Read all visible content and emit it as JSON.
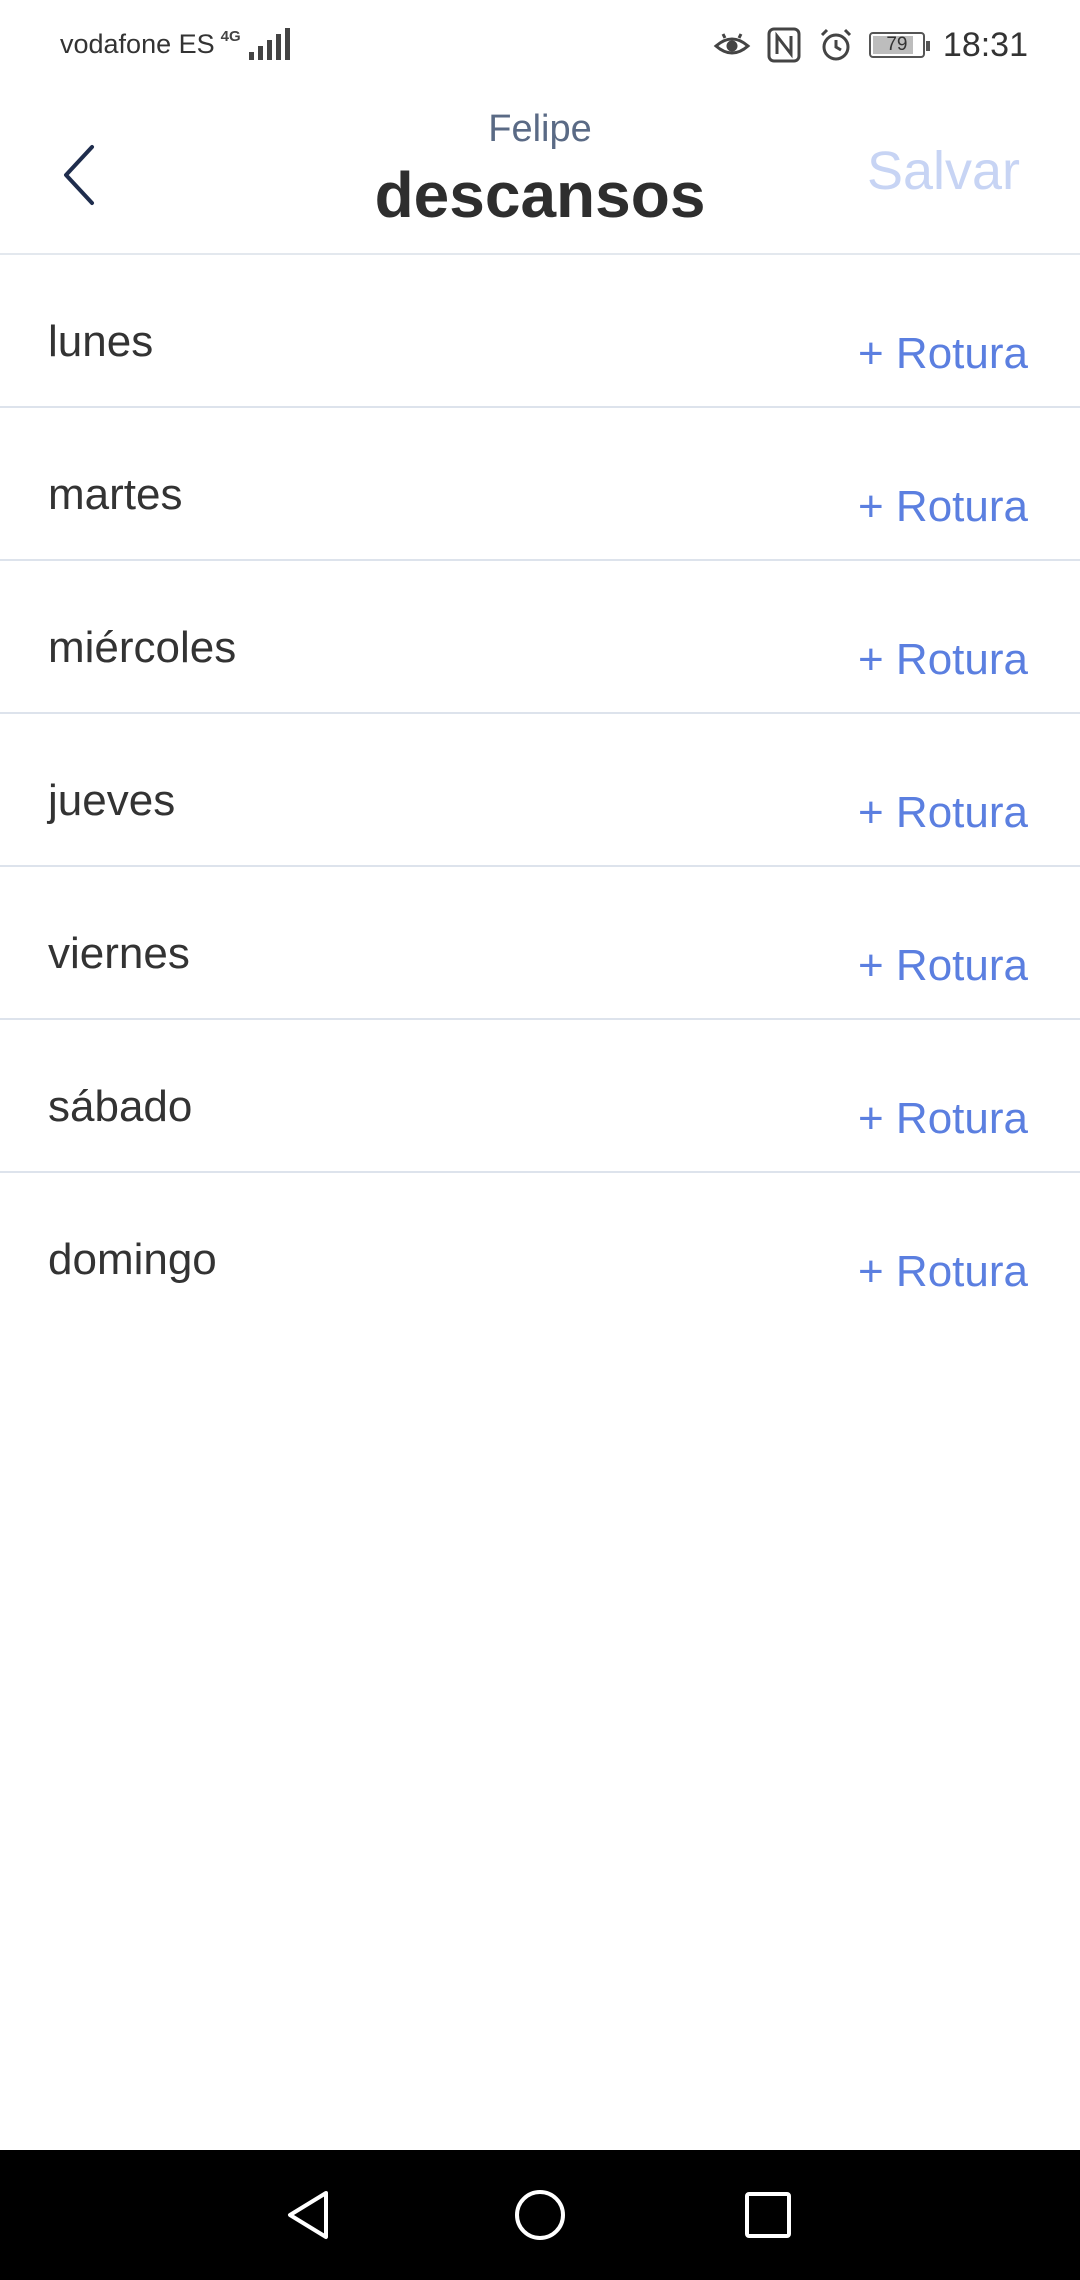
{
  "status_bar": {
    "carrier": "vodafone ES",
    "network_type": "4G",
    "battery_level": "79",
    "time": "18:31"
  },
  "header": {
    "subtitle": "Felipe",
    "title": "descansos",
    "save_label": "Salvar",
    "back_icon": "chevron-left-icon"
  },
  "days": [
    {
      "label": "lunes",
      "action": "+ Rotura"
    },
    {
      "label": "martes",
      "action": "+ Rotura"
    },
    {
      "label": "miércoles",
      "action": "+ Rotura"
    },
    {
      "label": "jueves",
      "action": "+ Rotura"
    },
    {
      "label": "viernes",
      "action": "+ Rotura"
    },
    {
      "label": "sábado",
      "action": "+ Rotura"
    },
    {
      "label": "domingo",
      "action": "+ Rotura"
    }
  ],
  "colors": {
    "accent": "#5b7fe0",
    "save_disabled": "#c7d4f4",
    "subtitle": "#5a6a85",
    "divider": "#dde3ec",
    "nav_bar": "#000000"
  }
}
